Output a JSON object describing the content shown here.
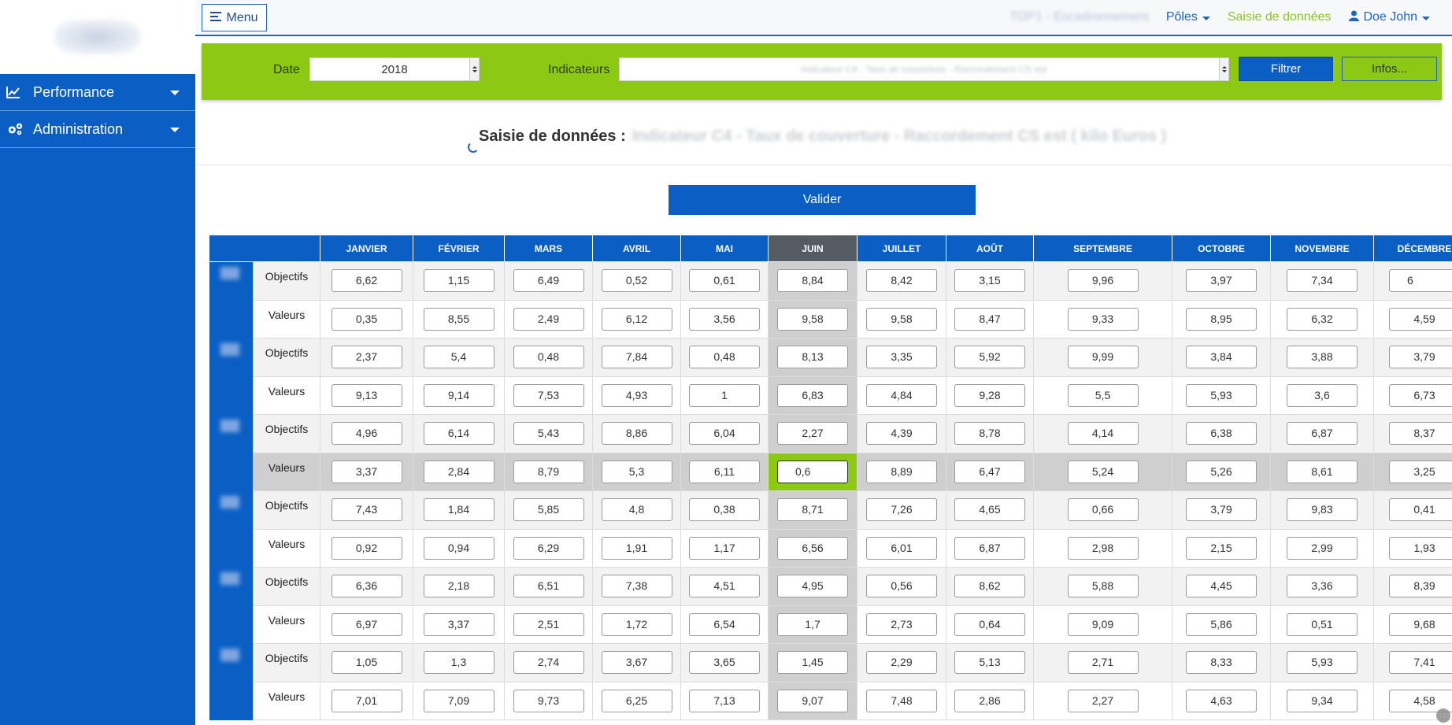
{
  "sidebar": {
    "logo_text": "eCap",
    "items": [
      {
        "label": "Performance",
        "icon": "chart-line-icon"
      },
      {
        "label": "Administration",
        "icon": "gears-icon"
      }
    ]
  },
  "topbar": {
    "menu_label": "Menu",
    "blurred_label": "TOP1 - Escadronnement",
    "poles_label": "Pôles",
    "saisie_label": "Saisie de données",
    "user_label": "Doe John"
  },
  "filters": {
    "date_label": "Date",
    "date_value": "2018",
    "indicateurs_label": "Indicateurs",
    "indicateurs_value": "Indicateur C4 - Taux de couverture - Raccordement CS est",
    "filter_button": "Filtrer",
    "info_button": "Infos..."
  },
  "page": {
    "title": "Saisie de données :",
    "title_suffix": "Indicateur C4 - Taux de couverture - Raccordement CS est ( kilo Euros )",
    "validate_button": "Valider"
  },
  "colors": {
    "primary_blue": "#0b5fc4",
    "accent_green": "#8cc814",
    "selected_header": "#555b63"
  },
  "table": {
    "months": [
      "JANVIER",
      "FÉVRIER",
      "MARS",
      "AVRIL",
      "MAI",
      "JUIN",
      "JUILLET",
      "AOÛT",
      "SEPTEMBRE",
      "OCTOBRE",
      "NOVEMBRE",
      "DÉCEMBRE"
    ],
    "selected_month": "JUIN",
    "entities": [
      {
        "name": "1",
        "objectifs": [
          "6,62",
          "1,15",
          "6,49",
          "0,52",
          "0,61",
          "8,84",
          "8,42",
          "3,15",
          "9,96",
          "3,97",
          "7,34",
          "6"
        ],
        "valeurs": [
          "0,35",
          "8,55",
          "2,49",
          "6,12",
          "3,56",
          "9,58",
          "9,58",
          "8,47",
          "9,33",
          "8,95",
          "6,32",
          "4,59"
        ]
      },
      {
        "name": "2",
        "objectifs": [
          "2,37",
          "5,4",
          "0,48",
          "7,84",
          "0,48",
          "8,13",
          "3,35",
          "5,92",
          "9,99",
          "3,84",
          "3,88",
          "3,79"
        ],
        "valeurs": [
          "9,13",
          "9,14",
          "7,53",
          "4,93",
          "1",
          "6,83",
          "4,84",
          "9,28",
          "5,5",
          "5,93",
          "3,6",
          "6,73"
        ]
      },
      {
        "name": "3",
        "objectifs": [
          "4,96",
          "6,14",
          "5,43",
          "8,86",
          "6,04",
          "2,27",
          "4,39",
          "8,78",
          "4,14",
          "6,38",
          "6,87",
          "8,37"
        ],
        "valeurs": [
          "3,37",
          "2,84",
          "8,79",
          "5,3",
          "6,11",
          "0,6",
          "8,89",
          "6,47",
          "5,24",
          "5,26",
          "8,61",
          "3,25"
        ]
      },
      {
        "name": "4",
        "objectifs": [
          "7,43",
          "1,84",
          "5,85",
          "4,8",
          "0,38",
          "8,71",
          "7,26",
          "4,65",
          "0,66",
          "3,79",
          "9,83",
          "0,41"
        ],
        "valeurs": [
          "0,92",
          "0,94",
          "6,29",
          "1,91",
          "1,17",
          "6,56",
          "6,01",
          "6,87",
          "2,98",
          "2,15",
          "2,99",
          "1,93"
        ]
      },
      {
        "name": "5",
        "objectifs": [
          "6,36",
          "2,18",
          "6,51",
          "7,38",
          "4,51",
          "4,95",
          "0,56",
          "8,62",
          "5,88",
          "4,45",
          "3,36",
          "8,39"
        ],
        "valeurs": [
          "6,97",
          "3,37",
          "2,51",
          "1,72",
          "6,54",
          "1,7",
          "2,73",
          "0,64",
          "9,09",
          "5,86",
          "0,51",
          "9,68"
        ]
      },
      {
        "name": "6",
        "objectifs": [
          "1,05",
          "1,3",
          "2,74",
          "3,67",
          "3,65",
          "1,45",
          "2,29",
          "5,13",
          "2,71",
          "8,33",
          "5,93",
          "7,41"
        ],
        "valeurs": [
          "7,01",
          "7,09",
          "9,73",
          "6,25",
          "7,13",
          "9,07",
          "7,48",
          "2,86",
          "2,27",
          "4,63",
          "9,34",
          "4,58"
        ]
      }
    ],
    "row_labels": {
      "objectifs": "Objectifs",
      "valeurs": "Valeurs"
    },
    "active_cell": {
      "entity": 2,
      "row": "valeurs",
      "month": 5
    }
  }
}
